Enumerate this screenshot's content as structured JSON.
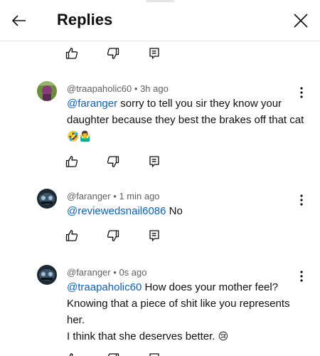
{
  "header": {
    "title": "Replies",
    "back_icon": "arrow-left-icon",
    "close_icon": "close-icon"
  },
  "colors": {
    "mention": "#065fd4",
    "meta": "#606060",
    "text": "#0f0f0f"
  },
  "comments": [
    {
      "author": "@traapaholic60",
      "separator": "•",
      "time": "3h ago",
      "mention": "@faranger",
      "text": " sorry to tell you sir they know your daughter because they best the brakes off that cat ",
      "emoji": "🤣🤷‍♂️"
    },
    {
      "author": "@faranger",
      "separator": "•",
      "time": "1 min ago",
      "mention": "@reviewedsnail6086",
      "text": " No"
    },
    {
      "author": "@faranger",
      "separator": "•",
      "time": "0s ago",
      "mention": "@traapaholic60",
      "text": "  How does your mother feel? Knowing that a piece of shit like you represents her.",
      "text2": "I think that she deserves better. ",
      "emoji": "😢"
    }
  ],
  "icons": {
    "like": "thumbs-up-icon",
    "dislike": "thumbs-down-icon",
    "reply": "reply-icon",
    "menu": "more-vertical-icon"
  }
}
